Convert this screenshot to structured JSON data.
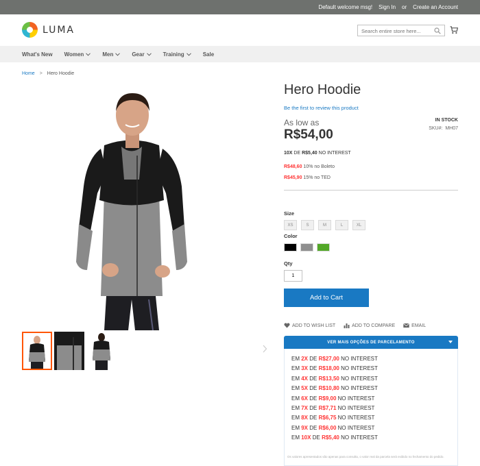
{
  "top_panel": {
    "welcome": "Default welcome msg!",
    "sign_in": "Sign In",
    "or": "or",
    "create_account": "Create an Account"
  },
  "header": {
    "logo_text": "LUMA",
    "search_placeholder": "Search entire store here..."
  },
  "nav": {
    "items": [
      "What's New",
      "Women",
      "Men",
      "Gear",
      "Training",
      "Sale"
    ]
  },
  "breadcrumb": {
    "home": "Home",
    "separator": ">",
    "current": "Hero Hoodie"
  },
  "product": {
    "title": "Hero Hoodie",
    "review_link": "Be the first to review this product",
    "as_low_as": "As low as",
    "price": "R$54,00",
    "stock": "IN STOCK",
    "sku_label": "SKU#:",
    "sku": "MH07",
    "installment": {
      "count": "10X",
      "de": "DE",
      "amount": "R$5,40",
      "suffix": "NO INTEREST"
    },
    "boleto": {
      "price": "R$48,60",
      "text": "10% no Boleto"
    },
    "ted": {
      "price": "R$45,90",
      "text": "15% no TED"
    },
    "size_label": "Size",
    "sizes": [
      "XS",
      "S",
      "M",
      "L",
      "XL"
    ],
    "color_label": "Color",
    "colors": [
      "#000000",
      "#8f8f8f",
      "#53a828"
    ],
    "qty_label": "Qty",
    "qty": "1",
    "add_to_cart": "Add to Cart",
    "wishlist": "ADD TO WISH LIST",
    "compare": "ADD TO COMPARE",
    "email": "EMAIL"
  },
  "parcelamento": {
    "header": "VER MAIS OPÇÕES DE PARCELAMENTO",
    "rows": [
      {
        "em": "EM",
        "n": "2X",
        "de": "DE",
        "amount": "R$27,00",
        "suffix": "NO INTEREST"
      },
      {
        "em": "EM",
        "n": "3X",
        "de": "DE",
        "amount": "R$18,00",
        "suffix": "NO INTEREST"
      },
      {
        "em": "EM",
        "n": "4X",
        "de": "DE",
        "amount": "R$13,50",
        "suffix": "NO INTEREST"
      },
      {
        "em": "EM",
        "n": "5X",
        "de": "DE",
        "amount": "R$10,80",
        "suffix": "NO INTEREST"
      },
      {
        "em": "EM",
        "n": "6X",
        "de": "DE",
        "amount": "R$9,00",
        "suffix": "NO INTEREST"
      },
      {
        "em": "EM",
        "n": "7X",
        "de": "DE",
        "amount": "R$7,71",
        "suffix": "NO INTEREST"
      },
      {
        "em": "EM",
        "n": "8X",
        "de": "DE",
        "amount": "R$6,75",
        "suffix": "NO INTEREST"
      },
      {
        "em": "EM",
        "n": "9X",
        "de": "DE",
        "amount": "R$6,00",
        "suffix": "NO INTEREST"
      },
      {
        "em": "EM",
        "n": "10X",
        "de": "DE",
        "amount": "R$5,40",
        "suffix": "NO INTEREST"
      }
    ],
    "note": "Os valores apresentados são apenas para consulta, o valor real da parcela será exibido no fechamento do pedido."
  }
}
